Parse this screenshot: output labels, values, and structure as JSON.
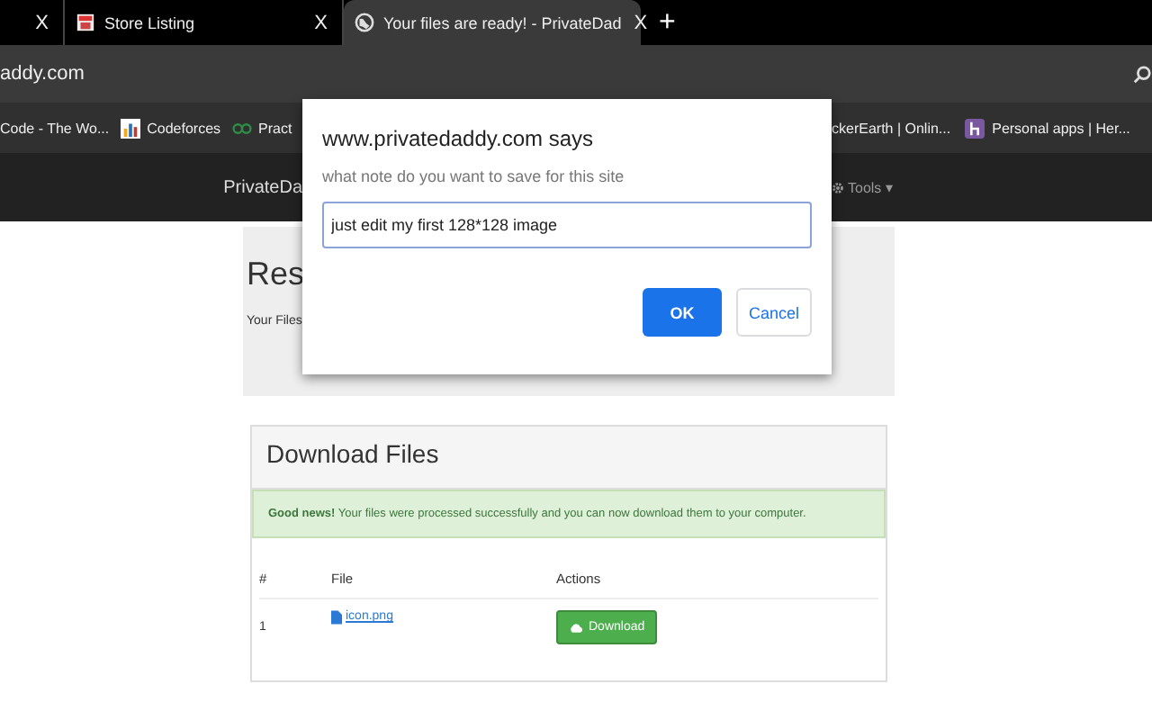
{
  "tabs": [
    {
      "close": "X",
      "selected": false
    },
    {
      "label": "Store Listing",
      "close": "X",
      "selected": false
    },
    {
      "label": "Your files are ready! - PrivateDad",
      "close": "X",
      "selected": true
    }
  ],
  "new_tab": "+",
  "address": "addy.com",
  "bookmarks_left": [
    "Code - The Wo...",
    "Codeforces",
    "Pract"
  ],
  "bookmarks_right": [
    "ckerEarth | Onlin...",
    "Personal apps | Her..."
  ],
  "site_nav": {
    "brand": "PrivateDa",
    "tools": "Tools",
    "caret": "▾"
  },
  "results": {
    "heading": "Res",
    "text": "Your Files"
  },
  "download": {
    "title": "Download Files",
    "alert": "**Good news!** Your files were processed successfully and you can now download them to your computer.",
    "columns": [
      "#",
      "File",
      "Actions"
    ],
    "rows": [
      {
        "index": "1",
        "file": "icon.png",
        "action": "Download"
      }
    ]
  },
  "dialog": {
    "title": "www.privatedaddy.com says",
    "message": "what note do you want to save for this site",
    "value": "just edit my first 128*128 image",
    "ok": "OK",
    "cancel": "Cancel"
  }
}
